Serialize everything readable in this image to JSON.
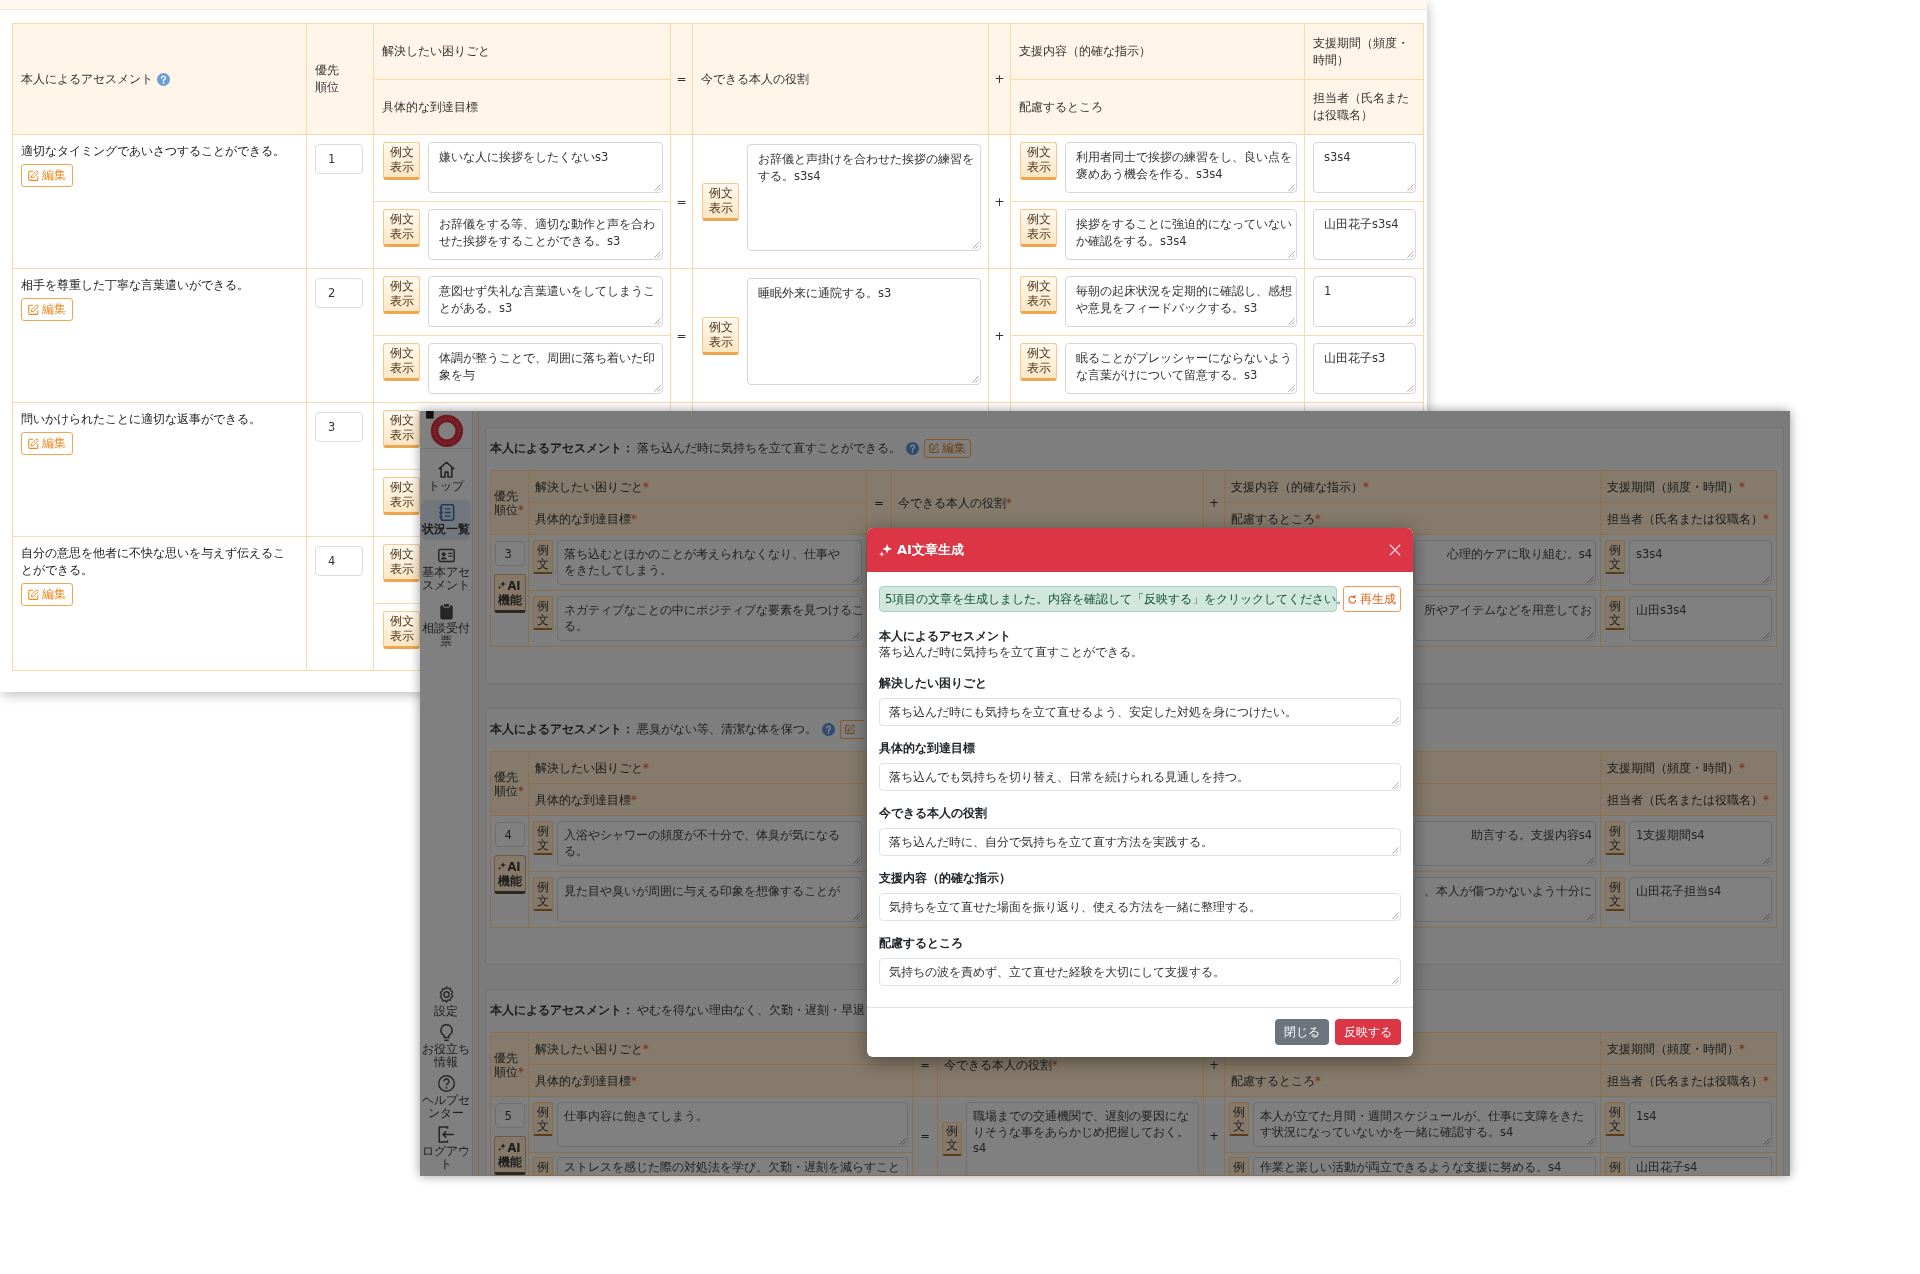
{
  "sheet": {
    "header": {
      "assessment": "本人によるアセスメント",
      "priority": "優先順位",
      "problem": "解決したい困りごと",
      "goal": "具体的な到達目標",
      "equals": "=",
      "role": "今できる本人の役割",
      "plus": "+",
      "support": "支援内容（的確な指示）",
      "care": "配慮するところ",
      "period": "支援期間（頻度・時間）",
      "staff": "担当者（氏名または役職名）"
    },
    "rows": [
      {
        "assessment": "適切なタイミングであいさつすることができる。",
        "edit": "編集",
        "priority": "1",
        "problem": {
          "button": "例文表示",
          "value": "嫌いな人に挨拶をしたくないs3"
        },
        "goal": {
          "button": "例文表示",
          "value": "お辞儀をする等、適切な動作と声を合わせた挨拶をすることができる。s3"
        },
        "equals": "=",
        "role": {
          "button": "例文表示",
          "value": "お辞儀と声掛けを合わせた挨拶の練習をする。s3s4"
        },
        "plus": "+",
        "support": {
          "button": "例文表示",
          "value": "利用者同士で挨拶の練習をし、良い点を褒めあう機会を作る。s3s4"
        },
        "care": {
          "button": "例文表示",
          "value": "挨拶をすることに強迫的になっていないか確認をする。s3s4"
        },
        "period": {
          "value": "s3s4"
        },
        "staff": {
          "value": "山田花子s3s4"
        }
      },
      {
        "assessment": "相手を尊重した丁寧な言葉遣いができる。",
        "edit": "編集",
        "priority": "2",
        "problem": {
          "button": "例文表示",
          "value": "意図せず失礼な言葉遣いをしてしまうことがある。s3"
        },
        "goal": {
          "button": "例文表示",
          "value": "体調が整うことで、周囲に落ち着いた印象を与"
        },
        "equals": "=",
        "role": {
          "button": "例文表示",
          "value": "睡眠外来に通院する。s3"
        },
        "plus": "+",
        "support": {
          "button": "例文表示",
          "value": "毎朝の起床状況を定期的に確認し、感想や意見をフィードバックする。s3"
        },
        "care": {
          "button": "例文表示",
          "value": "眠ることがプレッシャーにならないような言葉がけについて留意する。s3"
        },
        "period": {
          "value": "1"
        },
        "staff": {
          "value": "山田花子s3"
        }
      },
      {
        "assessment": "問いかけられたことに適切な返事ができる。",
        "edit": "編集",
        "priority": "3",
        "problem": {
          "button": "例文表示"
        },
        "goal": {
          "button": "例文表示"
        }
      },
      {
        "assessment": "自分の意思を他者に不快な思いを与えず伝えることができる。",
        "edit": "編集",
        "priority": "4",
        "problem": {
          "button": "例文表示"
        },
        "goal": {
          "button": "例文表示"
        }
      }
    ]
  },
  "app": {
    "sidebar": {
      "items": [
        {
          "label": "トップ",
          "selected": false
        },
        {
          "label": "状況一覧",
          "selected": true
        },
        {
          "label": "基本アセスメント",
          "selected": false
        },
        {
          "label": "相談受付票",
          "selected": false
        }
      ],
      "footer_items": [
        {
          "label": "設定",
          "selected": false
        },
        {
          "label": "お役立ち情報",
          "selected": false
        },
        {
          "label": "ヘルプセンター",
          "selected": false
        },
        {
          "label": "ログアウト",
          "selected": false
        }
      ]
    },
    "cards": [
      {
        "label": "本人によるアセスメント：",
        "assessment": "落ち込んだ時に気持ちを立て直すことができる。",
        "help_icon": true,
        "edit": {
          "kind": "full",
          "label": "編集"
        },
        "header": {
          "priority": {
            "text": "優先順位",
            "mark": "*"
          },
          "problem": {
            "text": "解決したい困りごと",
            "mark": "*"
          },
          "goal": {
            "text": "具体的な到達目標",
            "mark": "*"
          },
          "equals": {
            "text": "="
          },
          "role": {
            "text": "今できる本人の役割",
            "mark": "*"
          },
          "plus": {
            "text": "+"
          },
          "support": {
            "text": "支援内容（的確な指示）",
            "mark": "*"
          },
          "care": {
            "text": "配慮するところ",
            "mark": "*"
          },
          "period": {
            "text": "支援期間",
            "note": "（頻度・時間）",
            "mark": "*"
          },
          "staff": {
            "text": "担当者",
            "note": "（氏名または役職名）",
            "mark": "*"
          }
        },
        "rows": [
          {
            "priority": "3",
            "ai_button": "AI機能",
            "problem": {
              "button": "例文",
              "lines": [
                "落ち込むとほかのことが考えられなくなり、仕事や",
                "をきたしてしまう。"
              ]
            },
            "goal": {
              "button": "例文",
              "lines": [
                "ネガティブなことの中にポジティブな要素を見つけるこ",
                "る。"
              ]
            },
            "support": {
              "value": "心理的ケアに取り組む。s4"
            },
            "care": {
              "value": "所やアイテムなどを用意してお"
            },
            "period": {
              "button": "例文",
              "value": "s3s4"
            },
            "staff": {
              "button": "例文",
              "value": "山田s3s4"
            }
          }
        ]
      },
      {
        "label": "本人によるアセスメント：",
        "assessment": "悪臭がない等、清潔な体を保つ。",
        "help_icon": true,
        "edit": {
          "kind": "cut"
        },
        "header": {
          "priority": {
            "text": "優先順位",
            "mark": "*"
          },
          "problem": {
            "text": "解決したい困りごと",
            "mark": "*"
          },
          "goal": {
            "text": "具体的な到達目標",
            "mark": "*"
          },
          "period": {
            "text": "支援期間",
            "note": "（頻度・時間）",
            "mark": "*"
          },
          "staff": {
            "text": "担当者",
            "note": "（氏名または役職名）",
            "mark": "*"
          }
        },
        "rows": [
          {
            "priority": "4",
            "ai_button": "AI機能",
            "problem": {
              "button": "例文",
              "lines": [
                "入浴やシャワーの頻度が不十分で、体臭が気になる",
                "る。"
              ]
            },
            "goal": {
              "button": "例文",
              "value": "見た目や臭いが周囲に与える印象を想像することが"
            },
            "support": {
              "value": "助言する。支援内容s4"
            },
            "care": {
              "value": "、本人が傷つかないよう十分に"
            },
            "period": {
              "button": "例文",
              "value": "1支援期間s4"
            },
            "staff": {
              "button": "例文",
              "value": "山田花子担当s4"
            }
          }
        ]
      },
      {
        "label": "本人によるアセスメント：",
        "assessment": "やむを得ない理由なく、欠勤・遅刻・早退",
        "help_icon": false,
        "header": {
          "priority": {
            "text": "優先順位",
            "mark": "*"
          },
          "problem": {
            "text": "解決したい困りごと",
            "mark": "*"
          },
          "goal": {
            "text": "具体的な到達目標",
            "mark": "*"
          },
          "equals": {
            "text": "="
          },
          "role": {
            "text": "今できる本人の役割",
            "mark": "*"
          },
          "plus": {
            "text": "+"
          },
          "care": {
            "text": "配慮するところ",
            "mark": "*"
          },
          "period": {
            "text": "支援期間",
            "note": "（頻度・時間）",
            "mark": "*"
          },
          "staff": {
            "text": "担当者",
            "note": "（氏名または役職名）",
            "mark": "*"
          }
        },
        "rows": [
          {
            "priority": "5",
            "ai_button": "AI機能",
            "problem": {
              "button": "例文",
              "value": "仕事内容に飽きてしまう。"
            },
            "goal": {
              "button": "例",
              "value": "ストレスを感じた際の対処法を学び、欠勤・遅刻を減らすこと"
            },
            "equals": "=",
            "role": {
              "button": "例文",
              "value": "職場までの交通機関で、遅刻の要因になりそうな事をあらかじめ把握しておく。s4"
            },
            "plus": "+",
            "support": {
              "button": "例文",
              "value": "本人が立てた月間・週間スケジュールが、仕事に支障をきたす状況になっていないかを一緒に確認する。s4"
            },
            "care": {
              "button": "例",
              "value": "作業と楽しい活動が両立できるような支援に努める。s4"
            },
            "period": {
              "button": "例文",
              "value": "1s4"
            },
            "staff": {
              "button": "例",
              "value": "山田花子s4"
            }
          }
        ]
      }
    ],
    "dialog": {
      "title": "AI文章生成",
      "notice": "5項目の文章を生成しました。内容を確認して「反映する」をクリックしてください。",
      "regenerate": "再生成",
      "assessment_label": "本人によるアセスメント",
      "assessment": "落ち込んだ時に気持ちを立て直すことができる。",
      "fields": [
        {
          "label": "解決したい困りごと",
          "value": "落ち込んだ時にも気持ちを立て直せるよう、安定した対処を身につけたい。"
        },
        {
          "label": "具体的な到達目標",
          "value": "落ち込んでも気持ちを切り替え、日常を続けられる見通しを持つ。"
        },
        {
          "label": "今できる本人の役割",
          "value": "落ち込んだ時に、自分で気持ちを立て直す方法を実践する。"
        },
        {
          "label": "支援内容（的確な指示）",
          "value": "気持ちを立て直せた場面を振り返り、使える方法を一緒に整理する。"
        },
        {
          "label": "配慮するところ",
          "value": "気持ちの波を責めず、立て直せた経験を大切にして支援する。"
        }
      ],
      "buttons": [
        {
          "label": "閉じる",
          "kind": "secondary"
        },
        {
          "label": "反映する",
          "kind": "primary"
        }
      ]
    }
  }
}
